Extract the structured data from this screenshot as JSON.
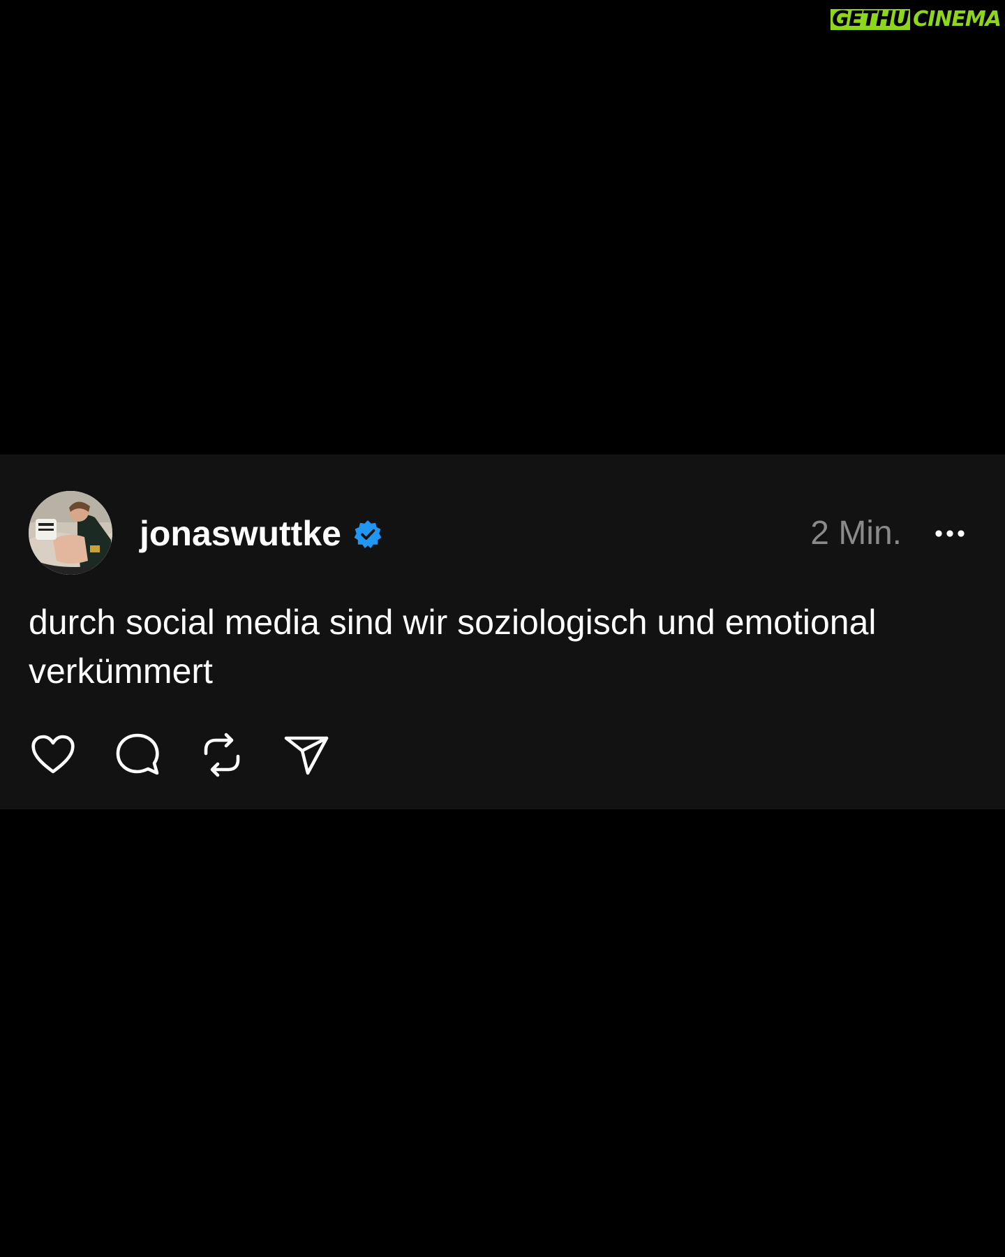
{
  "watermark": {
    "boxed": "GETHU",
    "rest": "CINEMA"
  },
  "post": {
    "username": "jonaswuttke",
    "verified": true,
    "timestamp": "2 Min.",
    "text": "durch social media sind wir soziologisch und emotional verkümmert"
  },
  "icons": {
    "verified": "verified-badge-icon",
    "more": "more-dots-icon",
    "like": "heart-icon",
    "comment": "comment-bubble-icon",
    "repost": "repost-icon",
    "share": "send-icon"
  },
  "colors": {
    "background": "#000000",
    "card": "#121212",
    "text": "#ffffff",
    "muted": "#8a8a8a",
    "verified": "#2196f3",
    "watermark": "#8ed61c"
  }
}
